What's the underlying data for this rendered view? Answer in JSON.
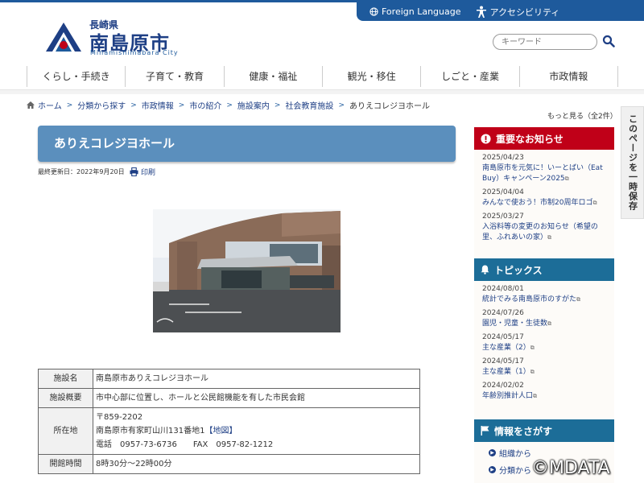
{
  "utility": {
    "foreign_language": "Foreign Language",
    "accessibility": "アクセシビリティ"
  },
  "logo": {
    "prefecture": "長崎県",
    "city": "南島原市",
    "romaji": "Minamishimabara City"
  },
  "search": {
    "placeholder": "キーワード"
  },
  "gnav": [
    "くらし・手続き",
    "子育て・教育",
    "健康・福祉",
    "観光・移住",
    "しごと・産業",
    "市政情報"
  ],
  "breadcrumb": [
    "ホーム",
    "分類から探す",
    "市政情報",
    "市の紹介",
    "施設案内",
    "社会教育施設",
    "ありえコレジヨホール"
  ],
  "page": {
    "title": "ありえコレジヨホール",
    "updated": "最終更新日：2022年9月20日",
    "print": "印刷"
  },
  "table": {
    "rows": [
      {
        "head": "施設名",
        "value": "南島原市ありえコレジヨホール"
      },
      {
        "head": "施設概要",
        "value": "市中心部に位置し、ホールと公民館機能を有した市民会館"
      },
      {
        "head": "所在地",
        "postal": "〒859-2202",
        "address": "南島原市有家町山川131番地1",
        "map": "【地図】",
        "tel": "電話　0957-73-6736　　FAX　0957-82-1212"
      },
      {
        "head": "開館時間",
        "value": "8時30分～22時00分"
      }
    ]
  },
  "sidebar": {
    "save_label": "このページを一時保存",
    "more": "もっと見る（全2件）",
    "notice_title": "重要なお知らせ",
    "notices": [
      {
        "date": "2025/04/23",
        "text": "南島原市を元気に！いーとばい（Eat Buy）キャンペーン2025"
      },
      {
        "date": "2025/04/04",
        "text": "みんなで使おう！市制20周年ロゴ"
      },
      {
        "date": "2025/03/27",
        "text": "入浴料等の変更のお知らせ（希望の里、ふれあいの家）"
      }
    ],
    "topics_title": "トピックス",
    "topics": [
      {
        "date": "2024/08/01",
        "text": "統計でみる南島原市のすがた"
      },
      {
        "date": "2024/07/26",
        "text": "園児・児童・生徒数"
      },
      {
        "date": "2024/05/17",
        "text": "主な産業（2）"
      },
      {
        "date": "2024/05/17",
        "text": "主な産業（1）"
      },
      {
        "date": "2024/02/02",
        "text": "年齢別推計人口"
      }
    ],
    "find_title": "情報をさがす",
    "find_items": [
      "組織から",
      "分類から"
    ]
  },
  "watermark": "©MDATA",
  "colors": {
    "brand": "#1e5a9c",
    "notice": "#c00018",
    "topics": "#1c6d98",
    "title_bg": "#5b8fbd"
  }
}
